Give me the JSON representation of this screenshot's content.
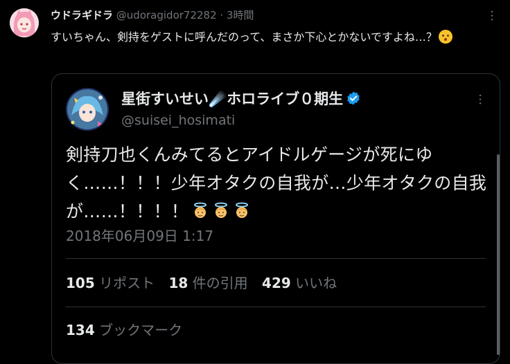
{
  "post": {
    "author_name": "ウドラギドラ",
    "handle": "@udoragidor72282",
    "separator": "·",
    "time": "3時間",
    "text": "すいちゃん、剣持をゲストに呼んだのって、まさか下心とかないですよね…？"
  },
  "quote": {
    "author_name": "星街すいせい☄️ホロライブ０期生",
    "handle": "@suisei_hosimati",
    "text": "剣持刀也くんみてるとアイドルゲージが死にゆく……！！！少年オタクの自我が…少年オタクの自我が……！！！！",
    "timestamp": "2018年06月09日 1:17",
    "reposts": {
      "count": "105",
      "label": "リポスト"
    },
    "quotes": {
      "count": "18",
      "label": "件の引用"
    },
    "likes": {
      "count": "429",
      "label": "いいね"
    },
    "bookmarks": {
      "count": "134",
      "label": "ブックマーク"
    }
  },
  "icons": {
    "verified": "verified-badge-icon",
    "more": "more-dots-icon",
    "emoji_hush": "hushed-face-emoji",
    "emoji_angel": "angel-emoji"
  },
  "colors": {
    "background": "#000000",
    "text": "#e7e9ea",
    "muted": "#71767b",
    "border": "#2f3336",
    "verified": "#1d9bf0"
  }
}
